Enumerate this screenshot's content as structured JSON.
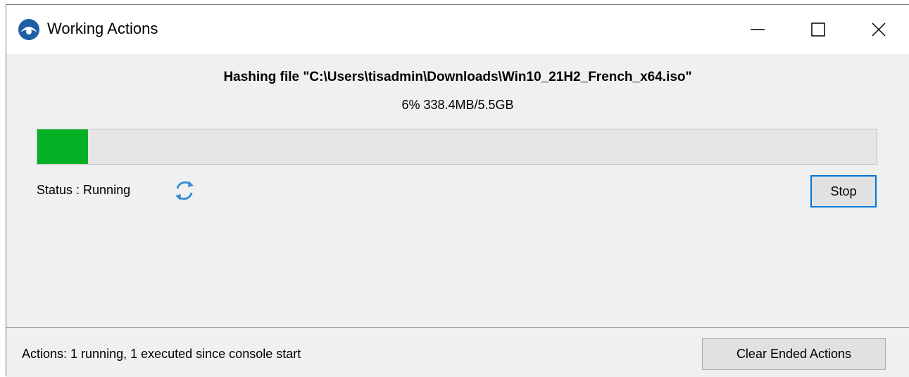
{
  "window": {
    "title": "Working Actions",
    "app_icon": "app-logo-icon",
    "controls": {
      "minimize_icon": "minimize-icon",
      "maximize_icon": "maximize-icon",
      "close_icon": "close-icon"
    }
  },
  "task": {
    "heading": "Hashing file \"C:\\Users\\tisadmin\\Downloads\\Win10_21H2_French_x64.iso\"",
    "progress_text": "6% 338.4MB/5.5GB",
    "progress_percent": 6,
    "progress_color": "#06b025",
    "status_label": "Status : Running",
    "status_icon": "refresh-spinner-icon",
    "stop_label": "Stop"
  },
  "footer": {
    "summary": "Actions: 1 running, 1 executed since console start",
    "clear_label": "Clear Ended Actions"
  },
  "colors": {
    "accent": "#0078d7",
    "spinner": "#3b8fd9",
    "background": "#f0f0f0"
  }
}
